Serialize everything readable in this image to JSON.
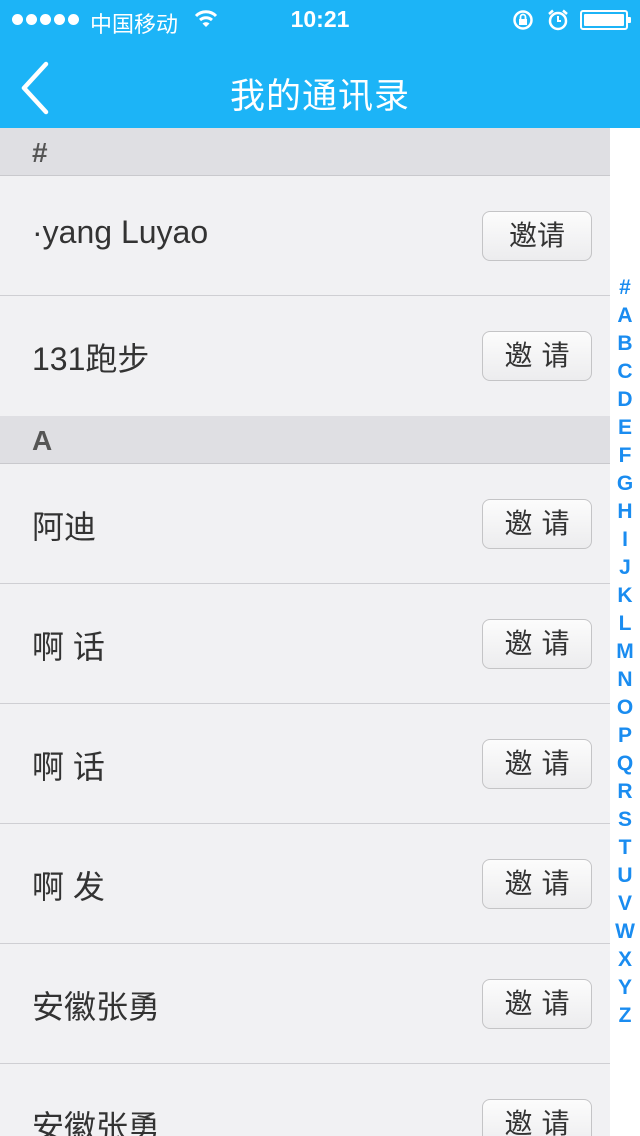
{
  "status": {
    "carrier": "中国移动",
    "time": "10:21"
  },
  "nav": {
    "title": "我的通讯录"
  },
  "sections": [
    {
      "header": "#",
      "contacts": [
        {
          "name": "·yang Luyao",
          "action": "邀请"
        },
        {
          "name": "131跑步",
          "action": "邀 请"
        }
      ]
    },
    {
      "header": "A",
      "contacts": [
        {
          "name": "阿迪",
          "action": "邀 请"
        },
        {
          "name": "啊 话",
          "action": "邀 请"
        },
        {
          "name": "啊 话",
          "action": "邀 请"
        },
        {
          "name": "啊 发",
          "action": "邀 请"
        },
        {
          "name": "安徽张勇",
          "action": "邀 请"
        },
        {
          "name": "安徽张勇",
          "action": "邀 请"
        }
      ]
    }
  ],
  "index_letters": [
    "#",
    "A",
    "B",
    "C",
    "D",
    "E",
    "F",
    "G",
    "H",
    "I",
    "J",
    "K",
    "L",
    "M",
    "N",
    "O",
    "P",
    "Q",
    "R",
    "S",
    "T",
    "U",
    "V",
    "W",
    "X",
    "Y",
    "Z"
  ],
  "colors": {
    "nav_bar": "#1cb4f7",
    "index_letter": "#1a8cf0"
  }
}
